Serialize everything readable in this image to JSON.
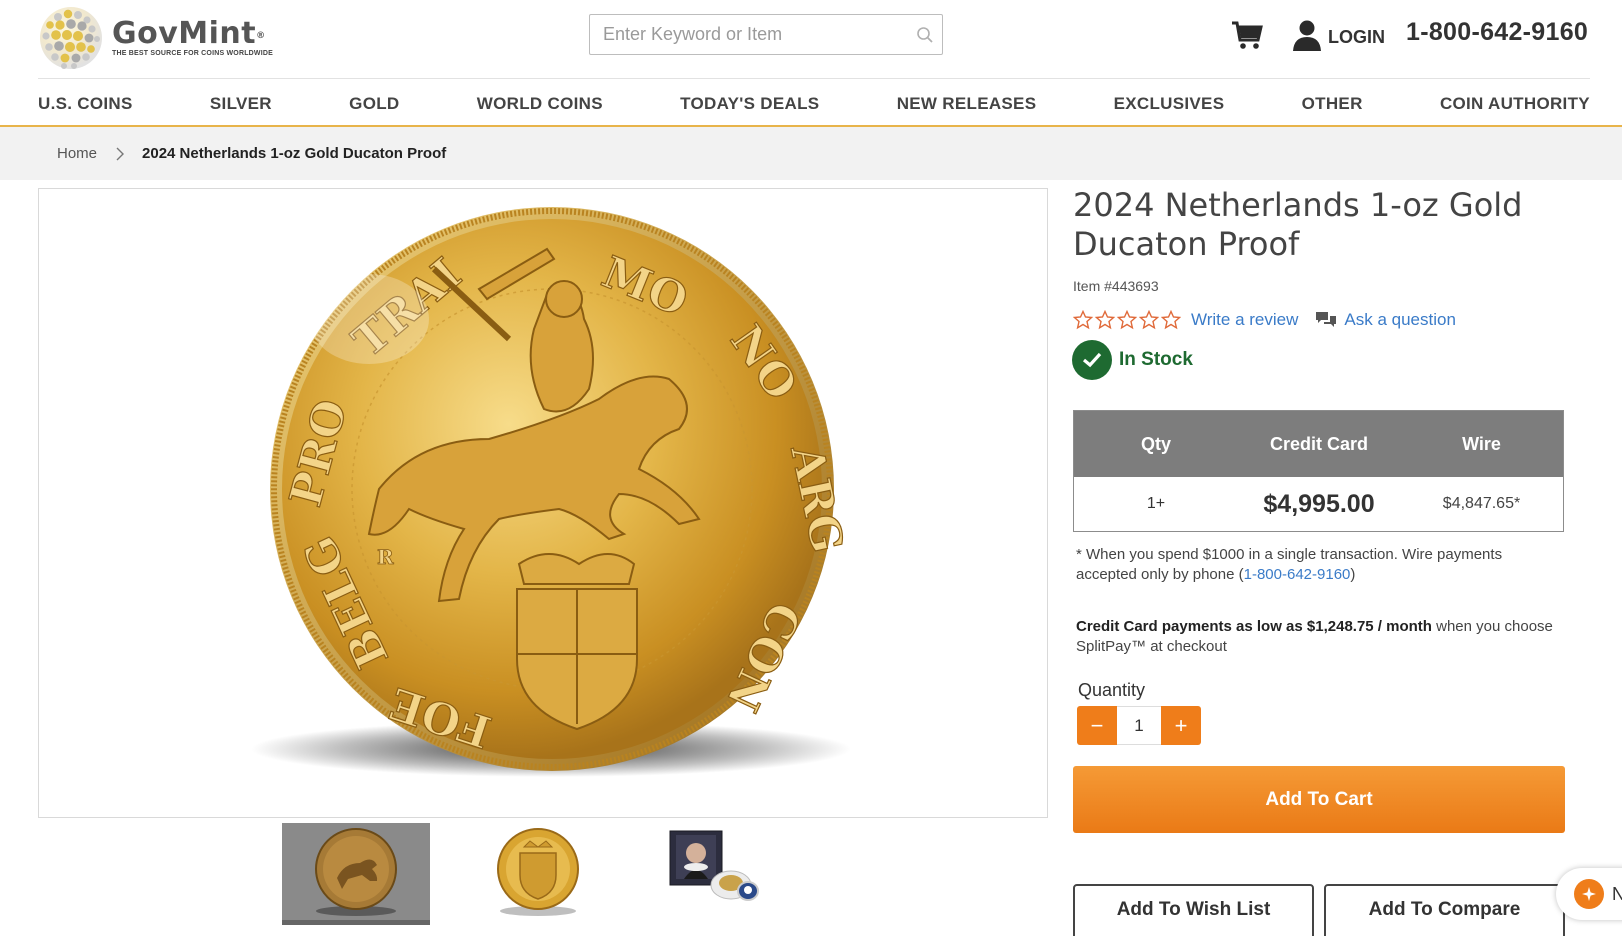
{
  "brand": {
    "name": "GovMint",
    "registered": "®",
    "tagline": "THE BEST SOURCE FOR COINS WORLDWIDE"
  },
  "search": {
    "placeholder": "Enter Keyword or Item",
    "value": ""
  },
  "header": {
    "login_label": "LOGIN",
    "phone": "1-800-642-9160"
  },
  "nav": {
    "items": [
      {
        "label": "U.S. COINS"
      },
      {
        "label": "SILVER"
      },
      {
        "label": "GOLD"
      },
      {
        "label": "WORLD COINS"
      },
      {
        "label": "TODAY'S DEALS"
      },
      {
        "label": "NEW RELEASES"
      },
      {
        "label": "EXCLUSIVES"
      },
      {
        "label": "OTHER"
      },
      {
        "label": "COIN AUTHORITY"
      }
    ]
  },
  "breadcrumb": {
    "home": "Home",
    "current": "2024 Netherlands 1-oz Gold Ducaton Proof"
  },
  "coin_legend": [
    "MO",
    "NO",
    "ARG",
    "CON",
    "FOE",
    "BELG",
    "PRO",
    "TRAI"
  ],
  "coin_mark": "R",
  "product": {
    "title": "2024 Netherlands 1-oz Gold Ducaton Proof",
    "item_number": "Item #443693",
    "rating": {
      "stars_filled": 0,
      "stars_total": 5
    },
    "write_review": "Write a review",
    "ask_question": "Ask a question",
    "stock": "In Stock"
  },
  "pricing": {
    "headers": {
      "qty": "Qty",
      "credit": "Credit Card",
      "wire": "Wire"
    },
    "rows": [
      {
        "qty": "1+",
        "credit": "$4,995.00",
        "wire": "$4,847.65*"
      }
    ]
  },
  "note": {
    "text": "* When you spend $1000 in a single transaction. Wire payments accepted only by phone (",
    "phone": "1-800-642-9160",
    "close": ")"
  },
  "splitpay": {
    "bold": "Credit Card payments as low as $1,248.75 / month",
    "rest": " when you choose SplitPay™ at checkout"
  },
  "quantity": {
    "label": "Quantity",
    "value": "1",
    "minus": "−",
    "plus": "+"
  },
  "actions": {
    "add_to_cart": "Add To Cart",
    "wish_list": "Add To Wish List",
    "compare": "Add To Compare"
  },
  "chat": {
    "letter": "N"
  },
  "colors": {
    "accent_orange": "#ef7d1a",
    "stock_green": "#1e6a31",
    "link_blue": "#3a7bc8",
    "nav_underline": "#e8b44a",
    "table_header": "#7d7d7d",
    "coin_gold": "#d9a531"
  },
  "icons": [
    "logo-globe-icon",
    "search-icon",
    "cart-icon",
    "user-icon",
    "chevron-right-icon",
    "star-outline-icon",
    "chat-bubbles-icon",
    "checkmark-icon",
    "sparkle-icon"
  ]
}
